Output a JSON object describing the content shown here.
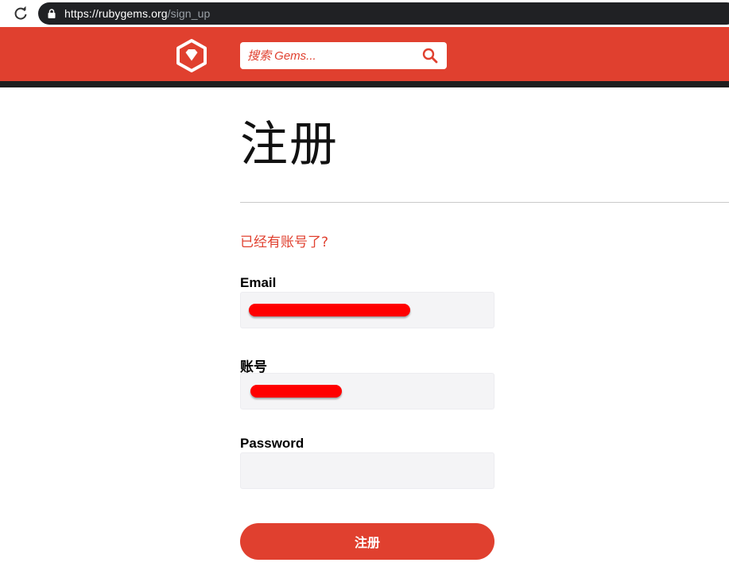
{
  "browser": {
    "url_host": "https://rubygems.org",
    "url_path": "/sign_up",
    "icons": [
      "reload-icon",
      "lock-icon"
    ]
  },
  "header": {
    "search_placeholder": "搜索 Gems...",
    "icons": [
      "rubygems-logo",
      "search-icon"
    ],
    "brand_color": "#e0402f"
  },
  "page": {
    "title": "注册",
    "signin_link": "已经有账号了?"
  },
  "form": {
    "email_label": "Email",
    "handle_label": "账号",
    "password_label": "Password",
    "email_value_redacted": true,
    "handle_value_redacted": true,
    "password_value": "",
    "submit_label": "注册"
  }
}
